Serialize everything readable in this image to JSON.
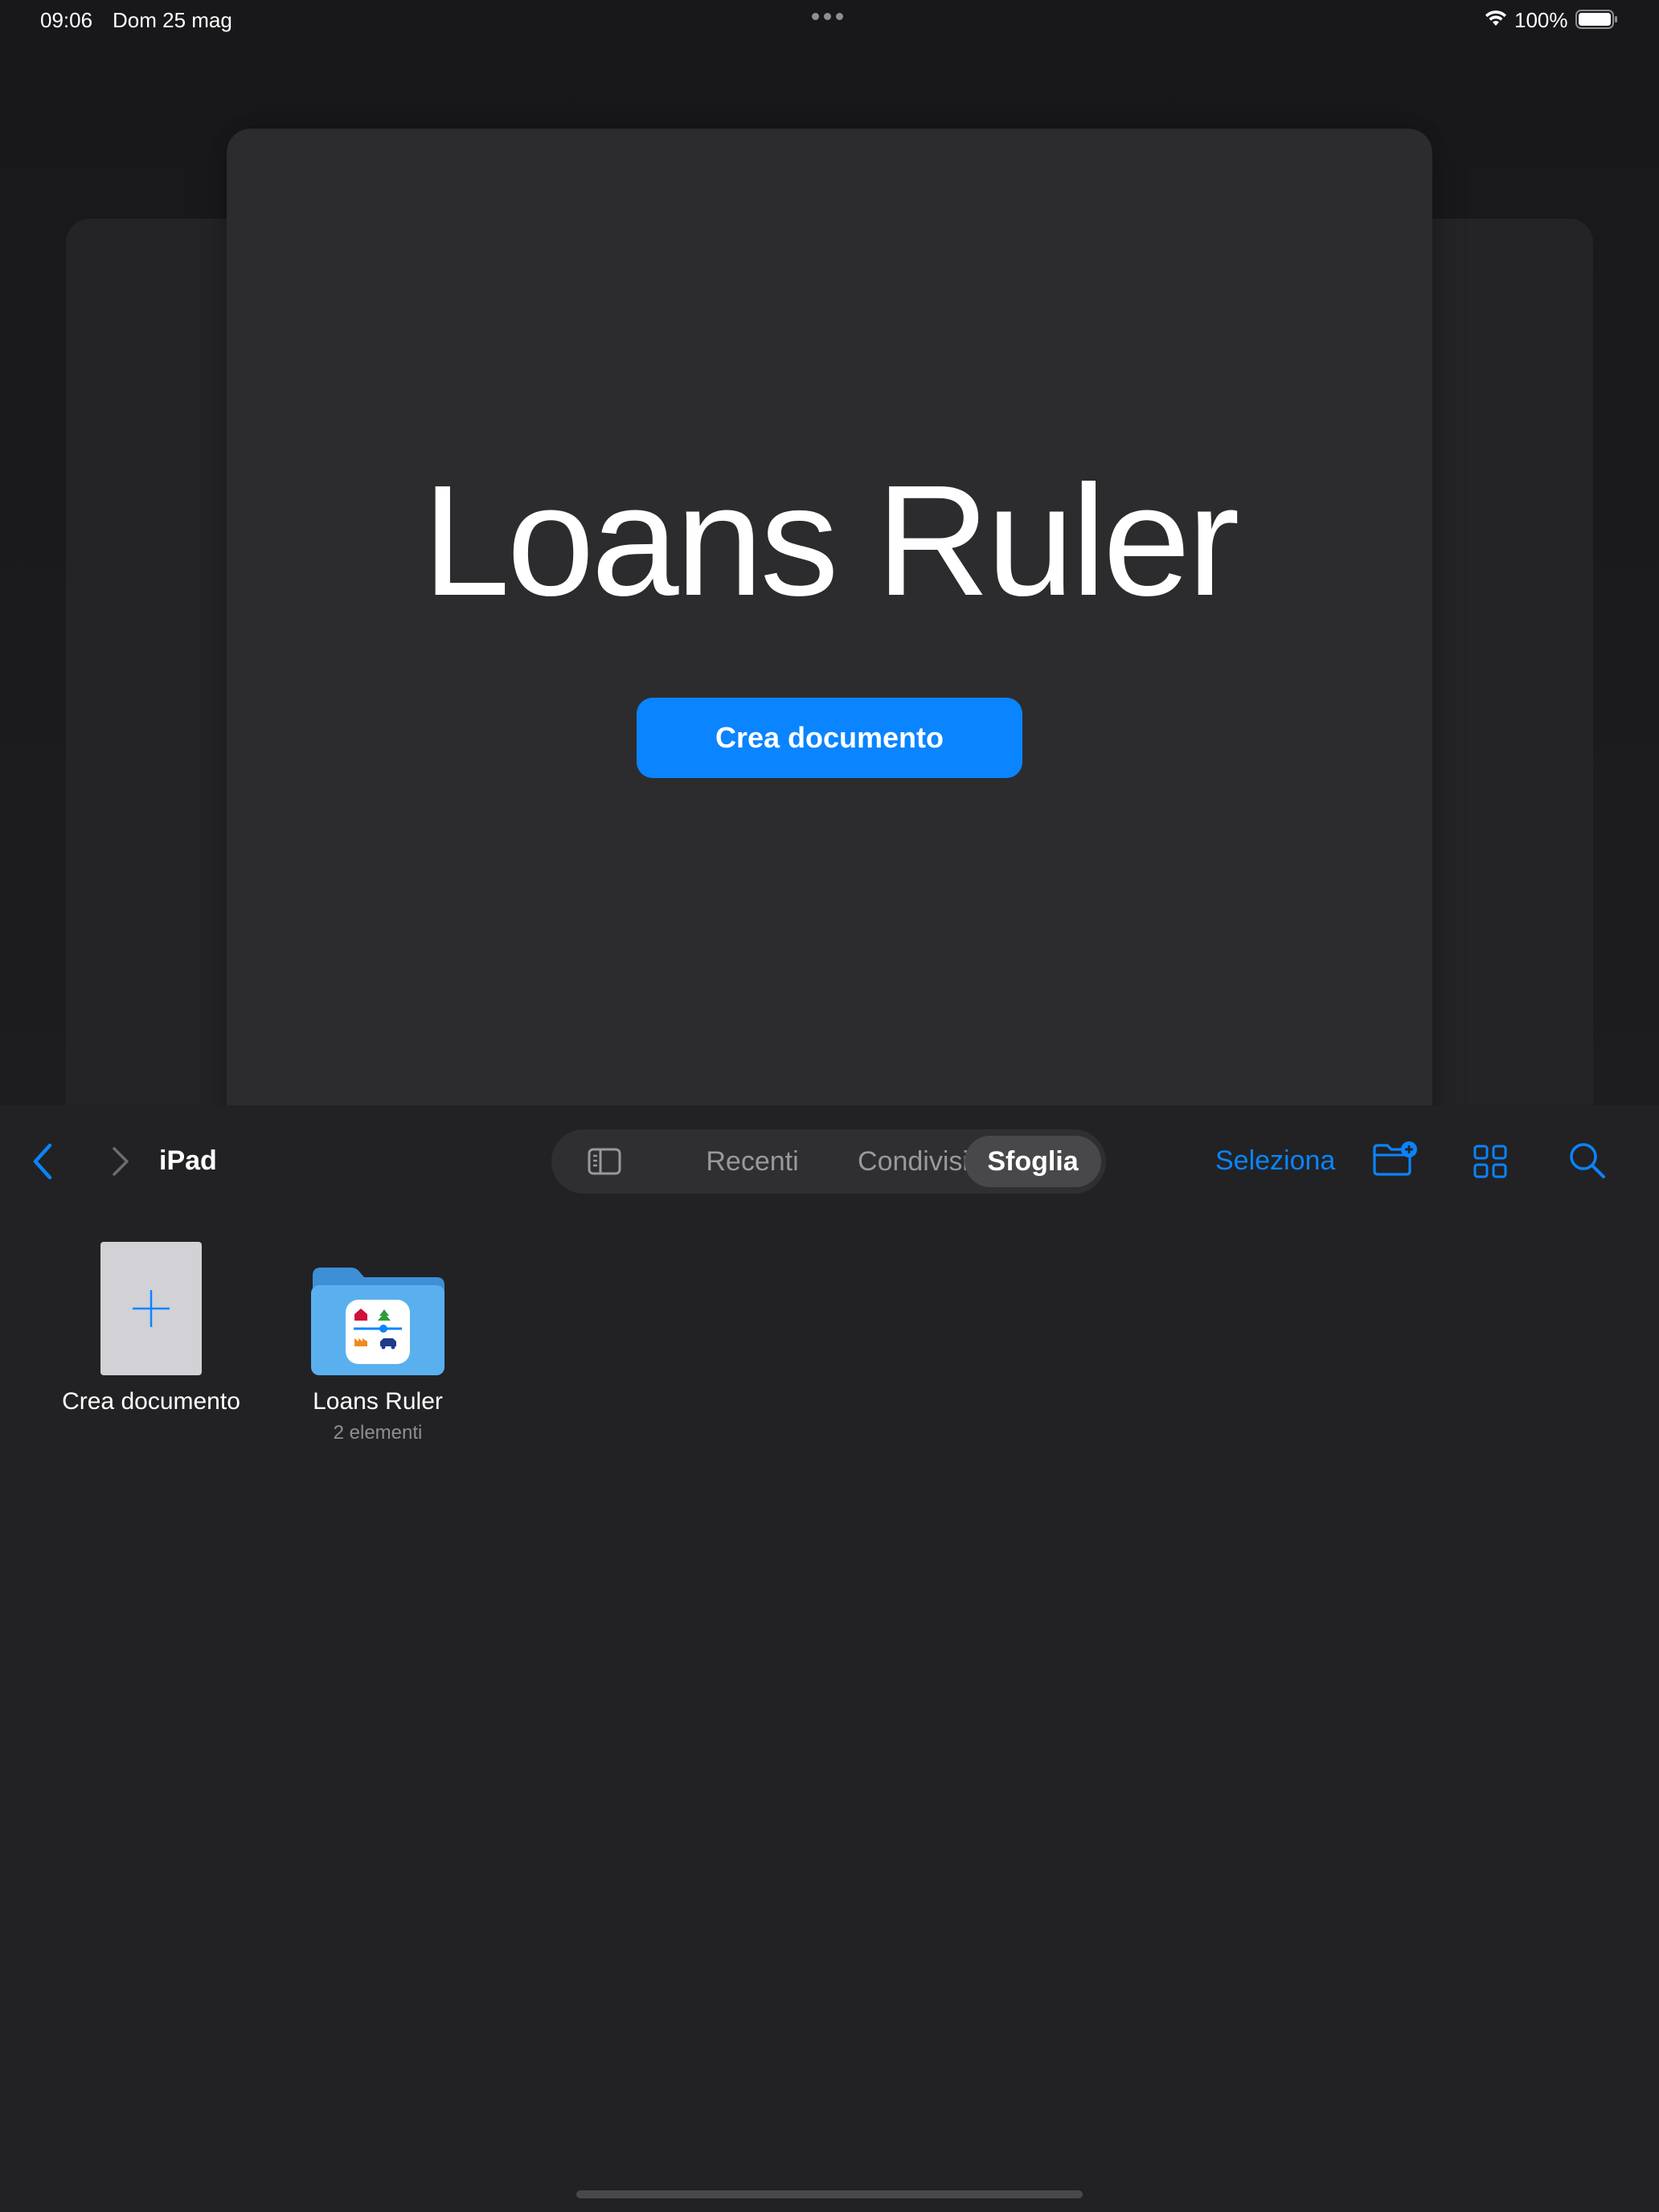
{
  "status_bar": {
    "time": "09:06",
    "date": "Dom 25 mag",
    "battery": "100%"
  },
  "hero": {
    "title": "Loans Ruler",
    "create_button": "Crea documento"
  },
  "toolbar": {
    "location": "iPad",
    "tabs": [
      {
        "label": "Recenti",
        "selected": false
      },
      {
        "label": "Condivisi",
        "selected": false
      },
      {
        "label": "Sfoglia",
        "selected": true
      }
    ],
    "select_label": "Seleziona"
  },
  "items": [
    {
      "label": "Crea documento",
      "kind": "create"
    },
    {
      "label": "Loans Ruler",
      "subtitle": "2 elementi",
      "kind": "folder"
    }
  ],
  "colors": {
    "accent": "#0a84ff",
    "folder": "#5ab0ee",
    "background": "#222224"
  }
}
